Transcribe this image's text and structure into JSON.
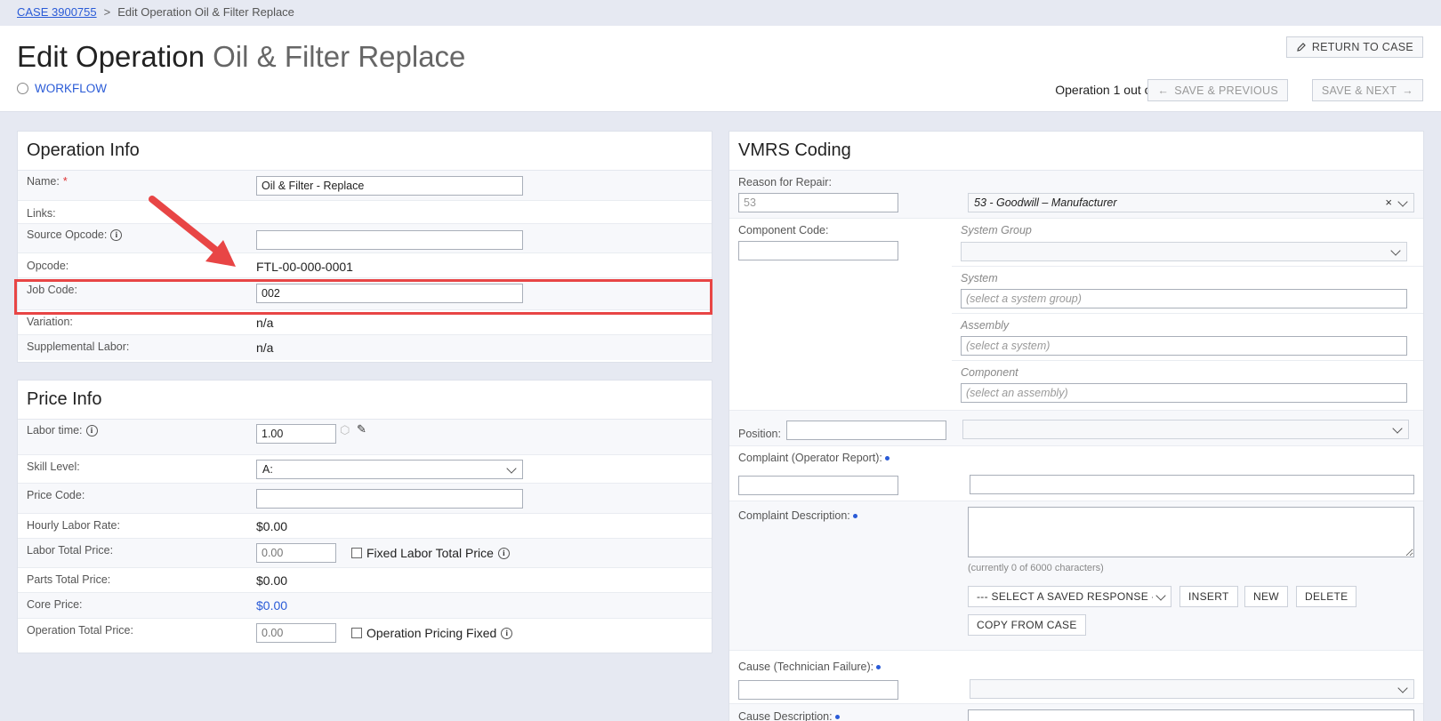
{
  "breadcrumb": {
    "case_link": "CASE 3900755",
    "separator": ">",
    "current": "Edit Operation Oil & Filter Replace"
  },
  "header": {
    "title_main": "Edit Operation",
    "title_sub": "Oil & Filter Replace",
    "workflow_label": "WORKFLOW",
    "return_label": "RETURN TO CASE",
    "op_count": "Operation 1 out of 1",
    "prev_label": "SAVE & PREVIOUS",
    "next_label": "SAVE & NEXT"
  },
  "operation_info": {
    "title": "Operation Info",
    "name_label": "Name:",
    "name_required": "*",
    "name_value": "Oil & Filter - Replace",
    "links_label": "Links:",
    "source_opcode_label": "Source Opcode:",
    "source_opcode_value": "",
    "opcode_label": "Opcode:",
    "opcode_value": "FTL-00-000-0001",
    "job_code_label": "Job Code:",
    "job_code_value": "002",
    "variation_label": "Variation:",
    "variation_value": "n/a",
    "supp_label": "Supplemental Labor:",
    "supp_value": "n/a"
  },
  "price_info": {
    "title": "Price Info",
    "labor_time_label": "Labor time:",
    "labor_time_value": "1.00",
    "skill_label": "Skill Level:",
    "skill_value": "A:",
    "price_code_label": "Price Code:",
    "price_code_value": "",
    "hourly_label": "Hourly Labor Rate:",
    "hourly_value": "$0.00",
    "labor_total_label": "Labor Total Price:",
    "labor_total_placeholder": "0.00",
    "fixed_labor_label": "Fixed Labor Total Price",
    "parts_total_label": "Parts Total Price:",
    "parts_total_value": "$0.00",
    "core_label": "Core Price:",
    "core_value": "$0.00",
    "op_total_label": "Operation Total Price:",
    "op_total_placeholder": "0.00",
    "op_fixed_label": "Operation Pricing Fixed"
  },
  "vmrs": {
    "title": "VMRS Coding",
    "reason_label": "Reason for Repair:",
    "reason_code": "53",
    "reason_select": "53 - Goodwill – Manufacturer",
    "component_label": "Component Code:",
    "system_group_label": "System Group",
    "system_label": "System",
    "system_placeholder": "(select a system group)",
    "assembly_label": "Assembly",
    "assembly_placeholder": "(select a system)",
    "component_sub_label": "Component",
    "component_placeholder": "(select an assembly)",
    "position_label": "Position:",
    "complaint_label": "Complaint (Operator Report):",
    "complaint_desc_label": "Complaint Description:",
    "char_count": "(currently 0 of 6000 characters)",
    "saved_response": "--- SELECT A SAVED RESPONSE ---",
    "insert_label": "INSERT",
    "new_label": "NEW",
    "delete_label": "DELETE",
    "copy_label": "COPY FROM CASE",
    "cause_label": "Cause (Technician Failure):",
    "cause_desc_label": "Cause Description:"
  }
}
